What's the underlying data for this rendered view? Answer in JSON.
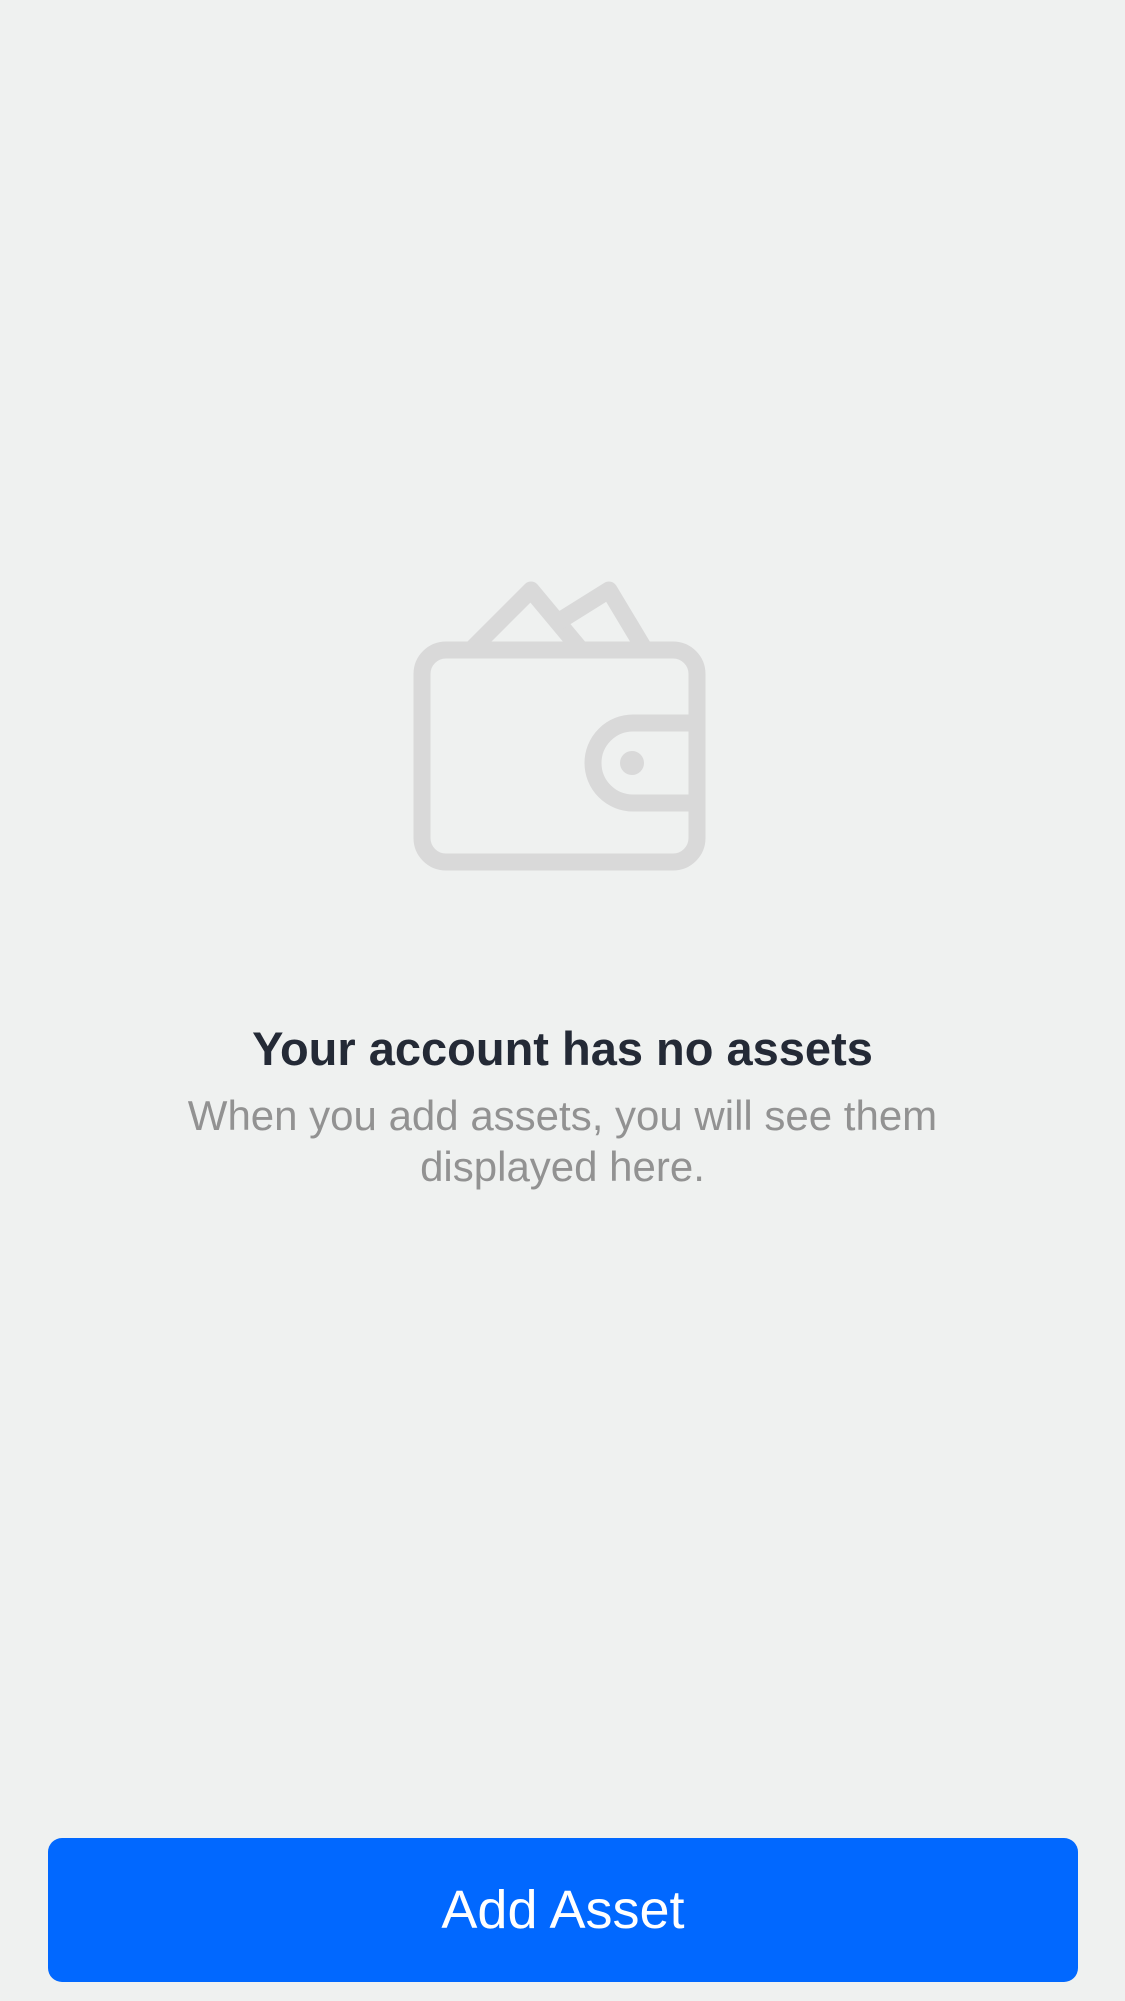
{
  "empty_state": {
    "icon": "wallet-icon",
    "icon_color": "#d9d9d9",
    "title": "Your account has no assets",
    "subtitle": "When you add assets, you will see them displayed here."
  },
  "actions": {
    "add_asset_label": "Add Asset",
    "primary_color": "#0168ff"
  }
}
